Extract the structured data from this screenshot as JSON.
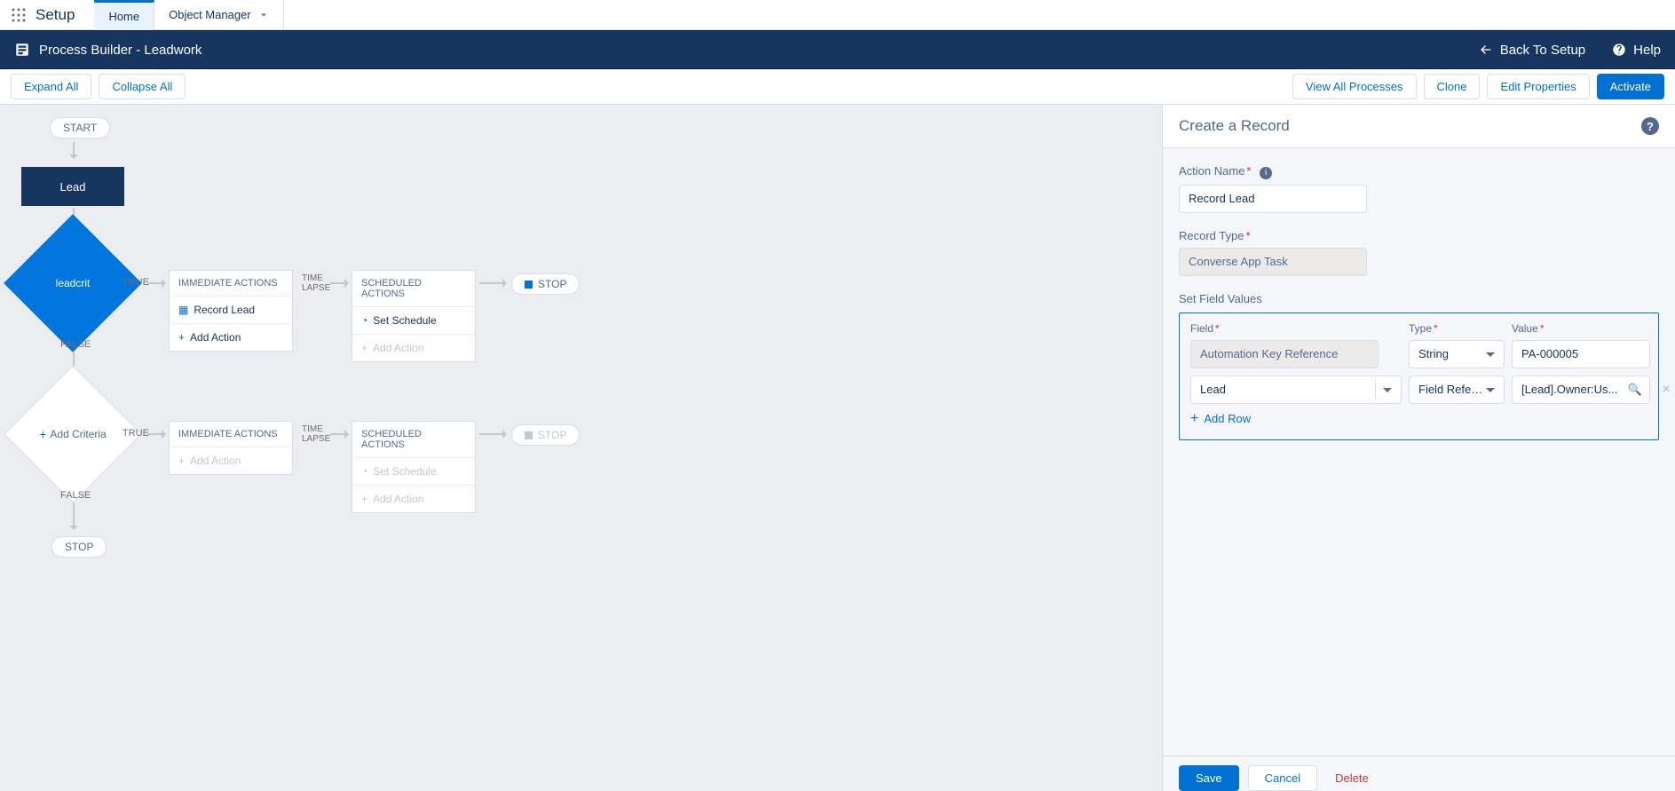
{
  "nav": {
    "setup": "Setup",
    "tabs": {
      "home": "Home",
      "object_manager": "Object Manager"
    }
  },
  "title_bar": {
    "label": "Process Builder - Leadwork",
    "back": "Back To Setup",
    "help": "Help"
  },
  "toolbar": {
    "expand": "Expand All",
    "collapse": "Collapse All",
    "view_all": "View All Processes",
    "clone": "Clone",
    "edit_props": "Edit Properties",
    "activate": "Activate"
  },
  "canvas": {
    "start": "START",
    "object": "Lead",
    "criteria_1": "leadcrit",
    "criteria_true": "TRUE",
    "criteria_false": "FALSE",
    "immediate_hdr": "IMMEDIATE ACTIONS",
    "scheduled_hdr": "SCHEDULED ACTIONS",
    "time_lapse": "TIME\nLAPSE",
    "action_record_lead": "Record Lead",
    "add_action": "Add Action",
    "set_schedule": "Set Schedule",
    "stop": "STOP",
    "add_criteria": "Add Criteria",
    "stop2": "STOP"
  },
  "panel": {
    "title": "Create a Record",
    "action_name_label": "Action Name",
    "action_name_value": "Record Lead",
    "record_type_label": "Record Type",
    "record_type_value": "Converse App Task",
    "set_fields_label": "Set Field Values",
    "hdr_field": "Field",
    "hdr_type": "Type",
    "hdr_value": "Value",
    "rows": [
      {
        "field": "Automation Key Reference",
        "type": "String",
        "value": "PA-000005",
        "field_disabled": true,
        "value_kind": "text"
      },
      {
        "field": "Lead",
        "type": "Field Reference",
        "value": "[Lead].Owner:Us...",
        "field_disabled": false,
        "value_kind": "lookup"
      }
    ],
    "add_row": "Add Row",
    "save": "Save",
    "cancel": "Cancel",
    "delete": "Delete"
  }
}
